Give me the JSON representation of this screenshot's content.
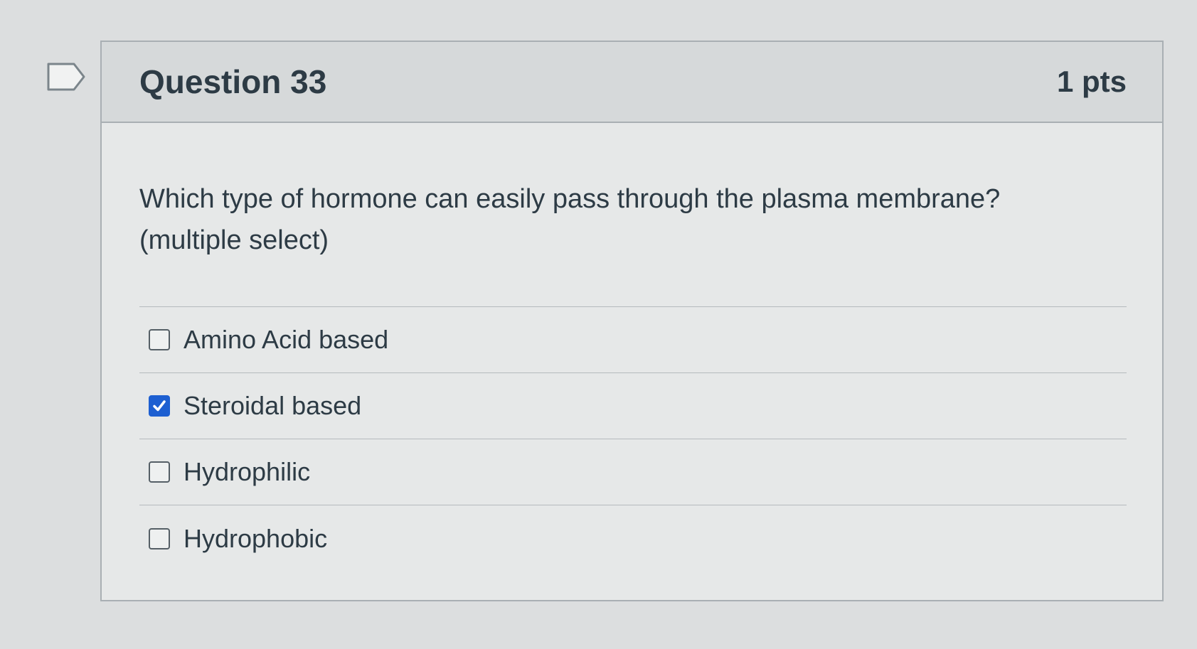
{
  "question": {
    "title": "Question 33",
    "points": "1 pts",
    "text_line1": "Which type of hormone can easily pass through the plasma membrane?",
    "text_line2": "(multiple select)",
    "flag_icon": "bookmark-flag-icon"
  },
  "answers": [
    {
      "label": "Amino Acid based",
      "checked": false
    },
    {
      "label": "Steroidal based",
      "checked": true
    },
    {
      "label": "Hydrophilic",
      "checked": false
    },
    {
      "label": "Hydrophobic",
      "checked": false
    }
  ],
  "colors": {
    "checkbox_checked": "#1d5fd1",
    "header_bg": "#d6d9da",
    "text": "#2d3b45"
  }
}
